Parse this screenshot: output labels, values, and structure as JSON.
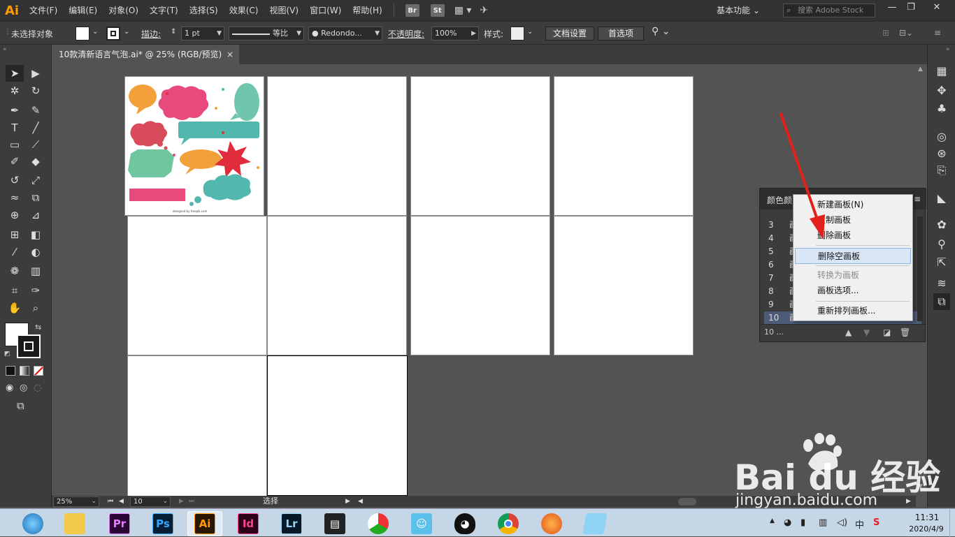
{
  "menubar": {
    "logo": "Ai",
    "items": [
      "文件(F)",
      "编辑(E)",
      "对象(O)",
      "文字(T)",
      "选择(S)",
      "效果(C)",
      "视图(V)",
      "窗口(W)",
      "帮助(H)"
    ],
    "bridge_badge": "Br",
    "stock_badge": "St",
    "workspace": "基本功能",
    "search_placeholder": "搜索 Adobe Stock"
  },
  "controlbar": {
    "selection_status": "未选择对象",
    "stroke_label": "描边:",
    "stroke_weight": "1 pt",
    "stroke_profile": "等比",
    "brush": "Redondo...",
    "opacity_label": "不透明度:",
    "opacity_value": "100%",
    "style_label": "样式:",
    "doc_setup_button": "文档设置",
    "preferences_button": "首选项"
  },
  "document": {
    "tab_title": "10款清新语言气泡.ai* @ 25% (RGB/预览)",
    "close_glyph": "×"
  },
  "artboard_panel": {
    "tabs": [
      "颜色",
      "颜"
    ],
    "rows": [
      {
        "num": "3",
        "name": "画"
      },
      {
        "num": "4",
        "name": "画"
      },
      {
        "num": "5",
        "name": "画"
      },
      {
        "num": "6",
        "name": "画"
      },
      {
        "num": "7",
        "name": "画"
      },
      {
        "num": "8",
        "name": "画"
      },
      {
        "num": "9",
        "name": "画"
      },
      {
        "num": "10",
        "name": "画"
      }
    ],
    "selected_row": "10",
    "footer_count": "10 ..."
  },
  "context_menu": {
    "items": [
      {
        "label": "新建画板(N)",
        "state": "normal"
      },
      {
        "label": "复制画板",
        "state": "normal"
      },
      {
        "label": "删除画板",
        "state": "normal"
      },
      {
        "label": "删除空画板",
        "state": "hover"
      },
      {
        "label": "转换为画板",
        "state": "disabled"
      },
      {
        "label": "画板选项...",
        "state": "normal"
      },
      {
        "label": "重新排列画板...",
        "state": "normal"
      }
    ]
  },
  "statusbar": {
    "zoom": "25%",
    "artboard_number": "10",
    "tool_status": "选择"
  },
  "taskbar": {
    "apps": [
      "Pr",
      "Ps",
      "Ai",
      "Id",
      "Lr"
    ],
    "active_app": "Ai",
    "ime_indicator": "中",
    "time": "11:31",
    "date": "2020/4/9"
  },
  "artwork": {
    "credit": "designed by freepik.com"
  },
  "watermark": {
    "brand": "Bai du 经验",
    "url": "jingyan.baidu.com"
  },
  "colors": {
    "accent_red": "#e3201b",
    "ai_orange": "#ff9a00",
    "selection_blue": "#4b5b78"
  }
}
